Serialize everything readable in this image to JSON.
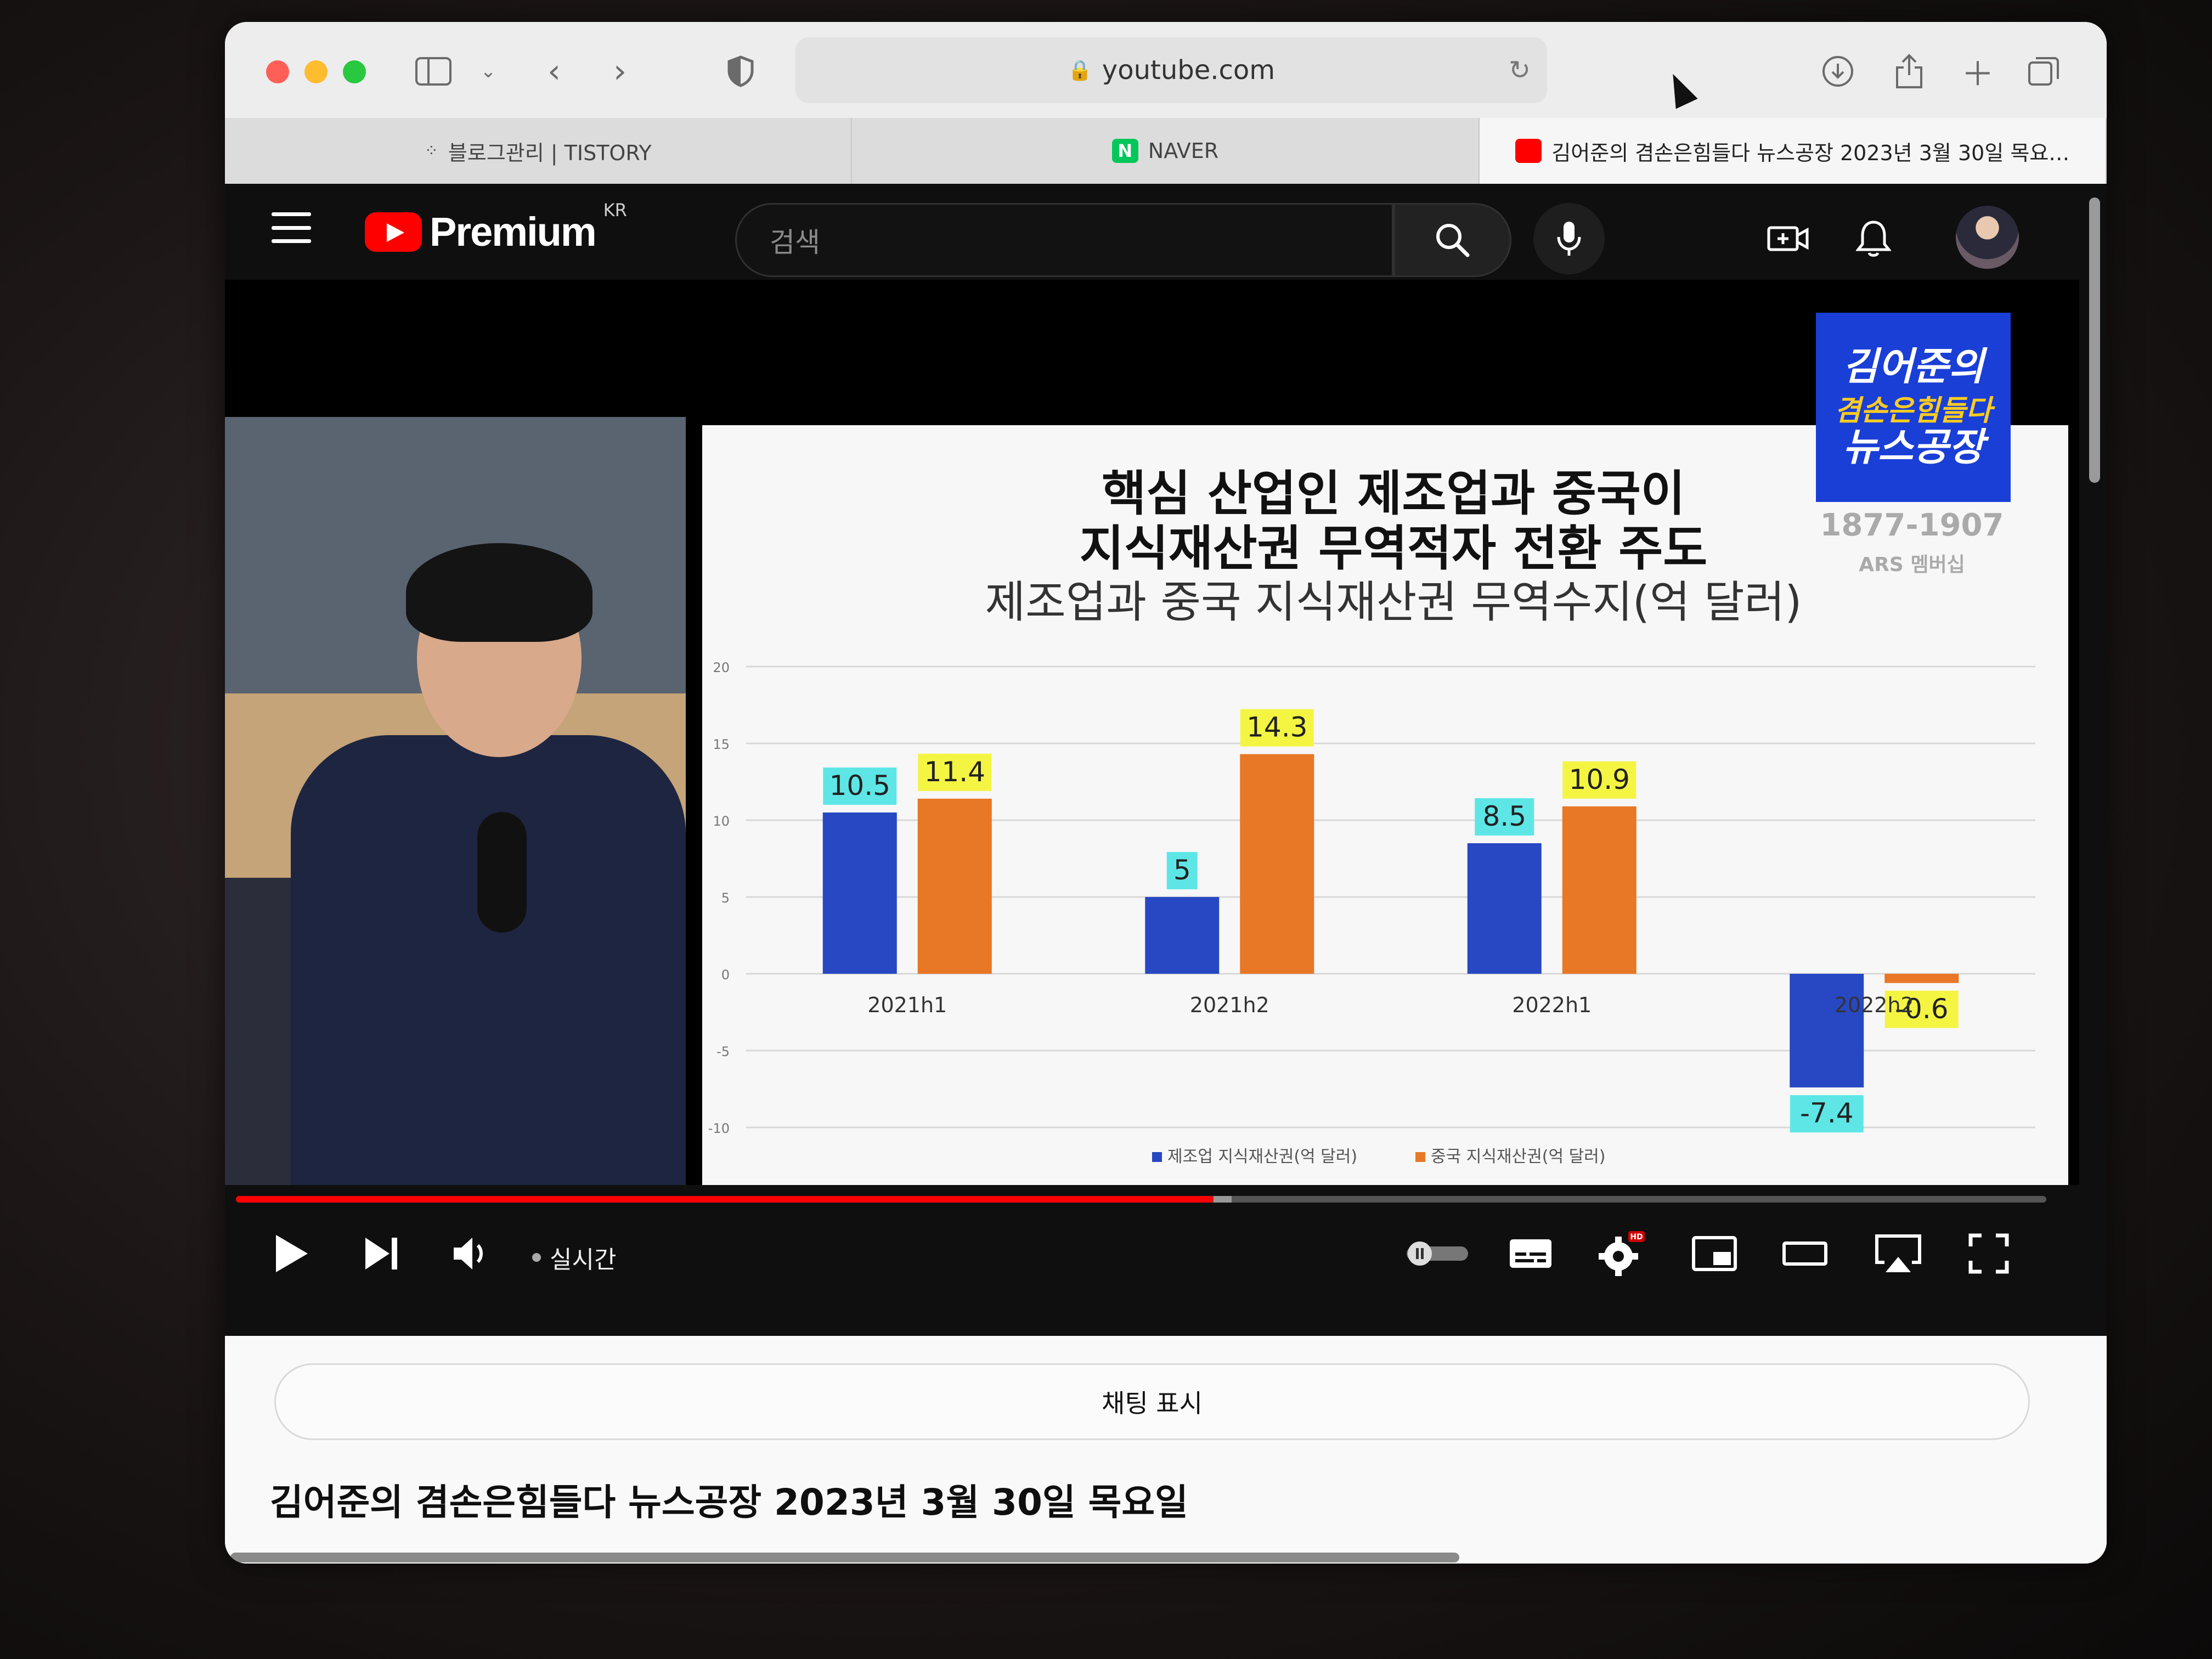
{
  "browser": {
    "url": "youtube.com",
    "tabs": [
      {
        "label": "블로그관리 | TISTORY"
      },
      {
        "label": "NAVER"
      },
      {
        "label": "김어준의 겸손은힘들다 뉴스공장 2023년 3월 30일 목요…"
      }
    ],
    "colors": {
      "close": "#ff5f57",
      "minimize": "#febc2e",
      "maximize": "#28c840"
    }
  },
  "youtube": {
    "logo_text": "Premium",
    "region": "KR",
    "search_placeholder": "검색"
  },
  "video": {
    "badge_line1": "김어준의",
    "badge_line2": "겸손은힘들다",
    "badge_line3": "뉴스공장",
    "badge_phone": "1877-1907",
    "badge_ars": "ARS 멤버십",
    "live_label": "실시간",
    "progress": 0.54,
    "buffered": 0.55,
    "hd_label": "HD"
  },
  "chart_data": {
    "type": "bar",
    "title_line1": "핵심 산업인 제조업과 중국이",
    "title_line2": "지식재산권 무역적자 전환 주도",
    "subtitle": "제조업과 중국 지식재산권 무역수지(억 달러)",
    "categories": [
      "2021h1",
      "2021h2",
      "2022h1",
      "2022h2"
    ],
    "series": [
      {
        "name": "제조업 지식재산권(억 달러)",
        "values": [
          10.5,
          5,
          8.5,
          -7.4
        ],
        "color": "#2748c2",
        "label_bg": "#5ee6e6"
      },
      {
        "name": "중국 지식재산권(억 달러)",
        "values": [
          11.4,
          14.3,
          10.9,
          -0.6
        ],
        "color": "#e87726",
        "label_bg": "#f4f542"
      }
    ],
    "ylim": [
      -10,
      20
    ],
    "yticks": [
      20,
      15,
      10,
      5,
      0,
      -5,
      -10
    ],
    "grid": true,
    "legend": "bottom"
  },
  "below": {
    "chat_button": "채팅 표시",
    "video_title": "김어준의 겸손은힘들다 뉴스공장 2023년 3월 30일 목요일"
  }
}
